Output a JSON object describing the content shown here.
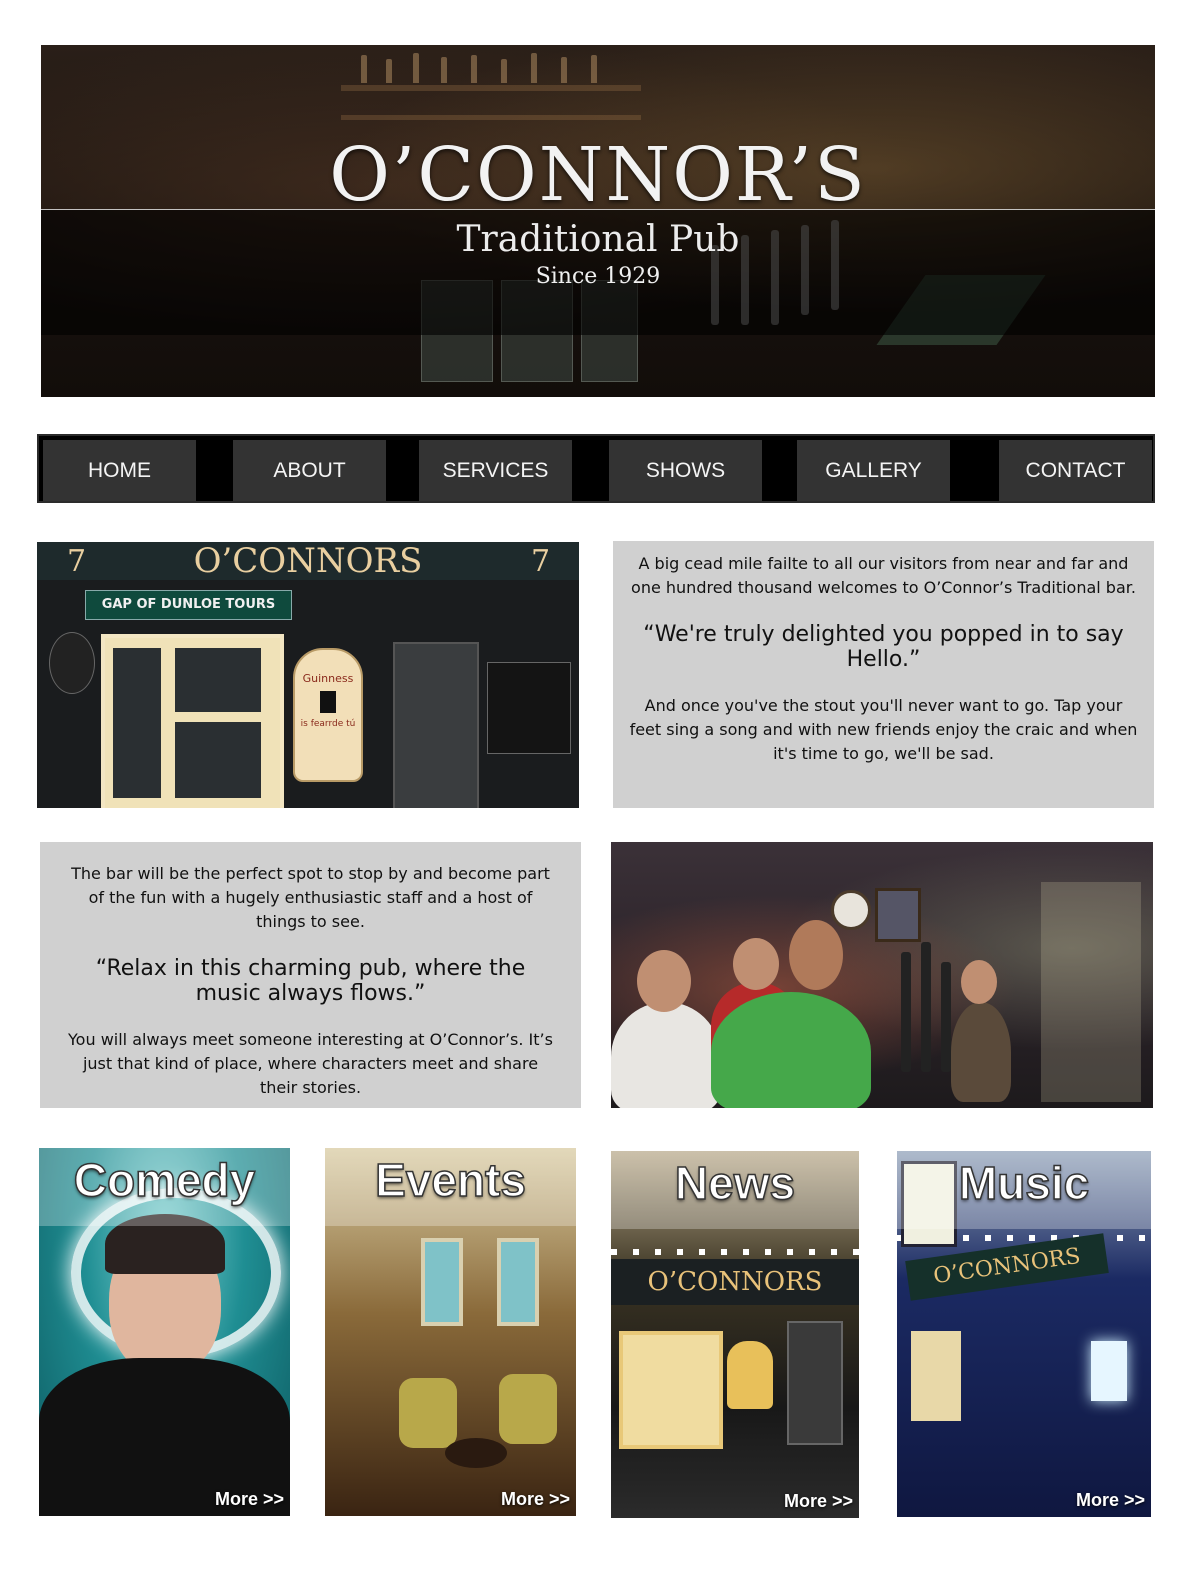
{
  "hero": {
    "title": "O’CONNOR’S",
    "subtitle": "Traditional Pub",
    "since": "Since 1929"
  },
  "nav": {
    "items": [
      {
        "label": "HOME"
      },
      {
        "label": "ABOUT"
      },
      {
        "label": "SERVICES"
      },
      {
        "label": "SHOWS"
      },
      {
        "label": "GALLERY"
      },
      {
        "label": "CONTACT"
      }
    ]
  },
  "shopfront": {
    "sign": "O’CONNORS",
    "number": "7",
    "tours_sign": "GAP OF DUNLOE TOURS",
    "guinness": "Guinness",
    "guinness_sub": "is fearrde tú"
  },
  "welcome": {
    "intro": "A big cead mile failte to all our visitors from near and far and one hundred thousand welcomes to O’Connor’s Traditional bar.",
    "quote": "“We're truly delighted you popped in to say Hello.”",
    "outro": "And once you've the stout you'll never want to go. Tap your feet sing a song and with new friends enjoy the craic and when it's time to go, we'll be sad."
  },
  "about": {
    "intro": "The bar will be the perfect spot to stop by and become part of the fun with a hugely enthusiastic staff and a host of things to see.",
    "quote": "“Relax in this charming pub, where the music always flows.”",
    "outro": "You will always meet someone interesting at O’Connor’s. It’s just that kind of place, where characters meet and share their stories."
  },
  "tiles": [
    {
      "title": "Comedy",
      "more": "More >>"
    },
    {
      "title": "Events",
      "more": "More >>"
    },
    {
      "title": "News",
      "more": "More >>"
    },
    {
      "title": "Music",
      "more": "More >>"
    }
  ],
  "colors": {
    "nav_bg": "#000000",
    "nav_item": "#333333",
    "panel": "#d0d0d0"
  }
}
